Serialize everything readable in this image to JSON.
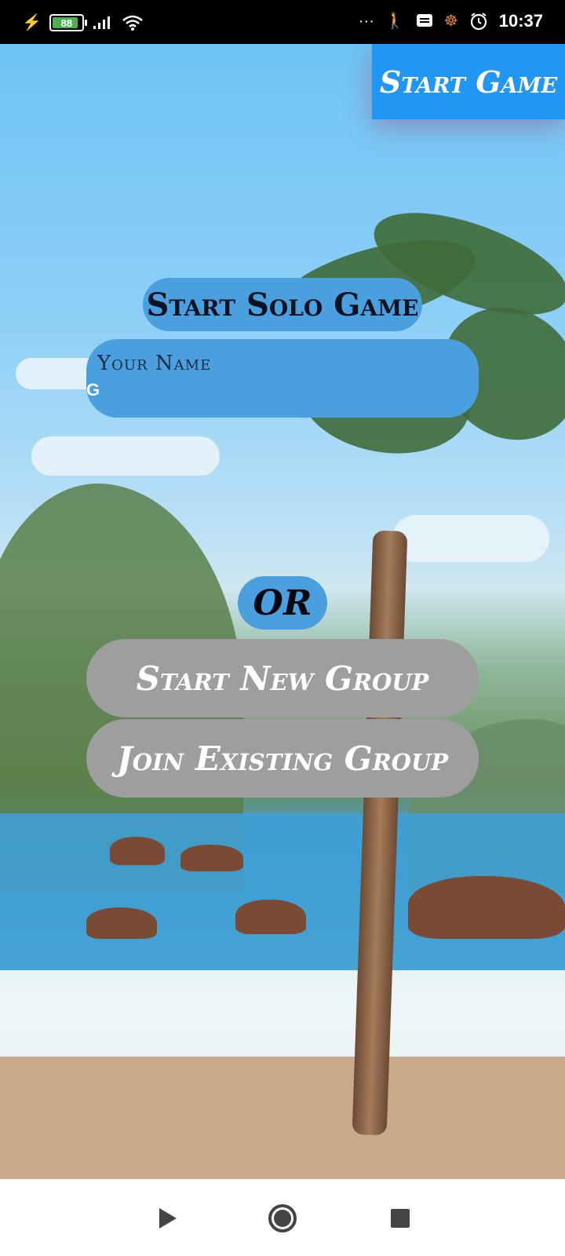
{
  "status_bar": {
    "battery_level": "88",
    "time": "10:37",
    "icons": [
      "charging-bolt-icon",
      "battery-icon",
      "signal-icon",
      "wifi-icon",
      "more-dots-icon",
      "walking-icon",
      "message-icon",
      "wheel-icon",
      "alarm-icon"
    ]
  },
  "header": {
    "start_game_label": "Start Game"
  },
  "solo": {
    "title": "Start Solo Game",
    "name_placeholder": "Your Name",
    "name_value": "G"
  },
  "divider": {
    "or_label": "OR"
  },
  "group": {
    "start_new_label": "Start New Group",
    "join_existing_label": "Join Existing Group"
  },
  "nav_bar": {
    "icons": [
      "back-icon",
      "home-icon",
      "recents-icon"
    ]
  },
  "colors": {
    "primary_blue": "#2196f3",
    "panel_blue": "#4a9fdf",
    "group_button_gray": "#9e9e9e"
  }
}
